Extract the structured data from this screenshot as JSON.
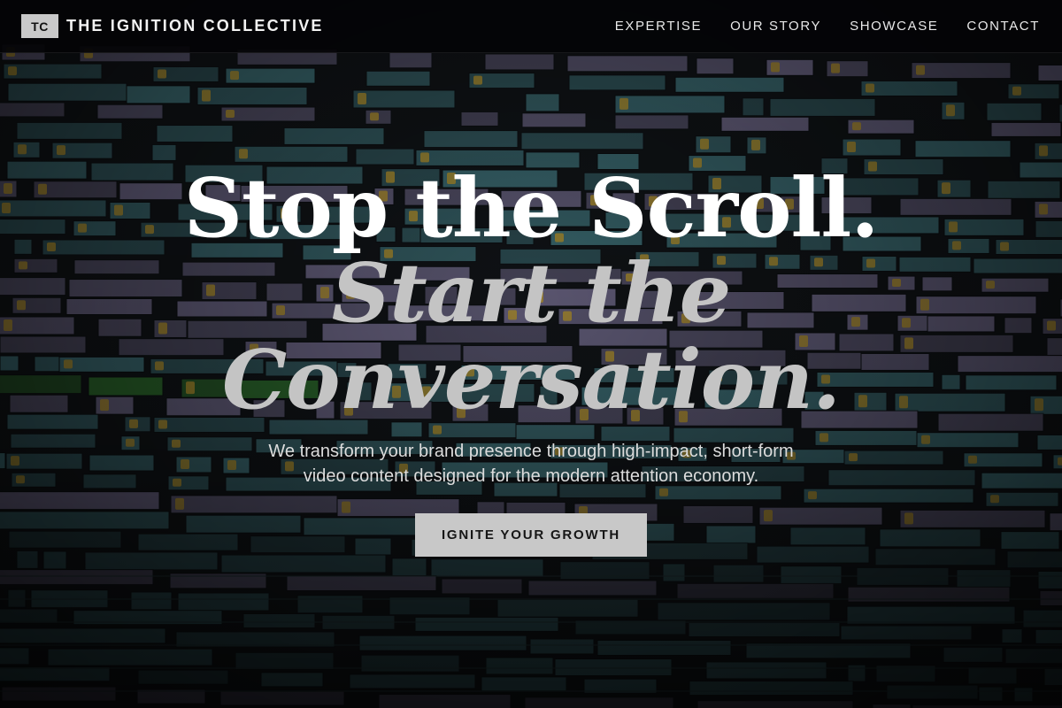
{
  "header": {
    "logo_mark": "TC",
    "brand_name": "THE IGNITION COLLECTIVE",
    "nav": [
      {
        "label": "EXPERTISE"
      },
      {
        "label": "OUR STORY"
      },
      {
        "label": "SHOWCASE"
      },
      {
        "label": "CONTACT"
      }
    ]
  },
  "hero": {
    "headline_line1": "Stop the Scroll.",
    "headline_line2": "Start the",
    "headline_line3": "Conversation.",
    "subtitle_line1": "We transform your brand presence through high-impact, short-form",
    "subtitle_line2": "video content designed for the modern attention economy.",
    "cta_label": "IGNITE YOUR GROWTH"
  },
  "background": {
    "description_icon": "video-editing-timeline-image",
    "colors": {
      "teal_clip": "#4f8f98",
      "lavender_clip": "#8e86b0",
      "yellow_badge": "#d8b23a",
      "green_clip": "#3b8f3a",
      "dark": "#14181c"
    }
  },
  "colors": {
    "header_bg": "#050507",
    "headline_white": "#ffffff",
    "headline_gray": "#c4c4c4",
    "cta_bg": "#c8c8c8",
    "cta_text": "#161616"
  }
}
